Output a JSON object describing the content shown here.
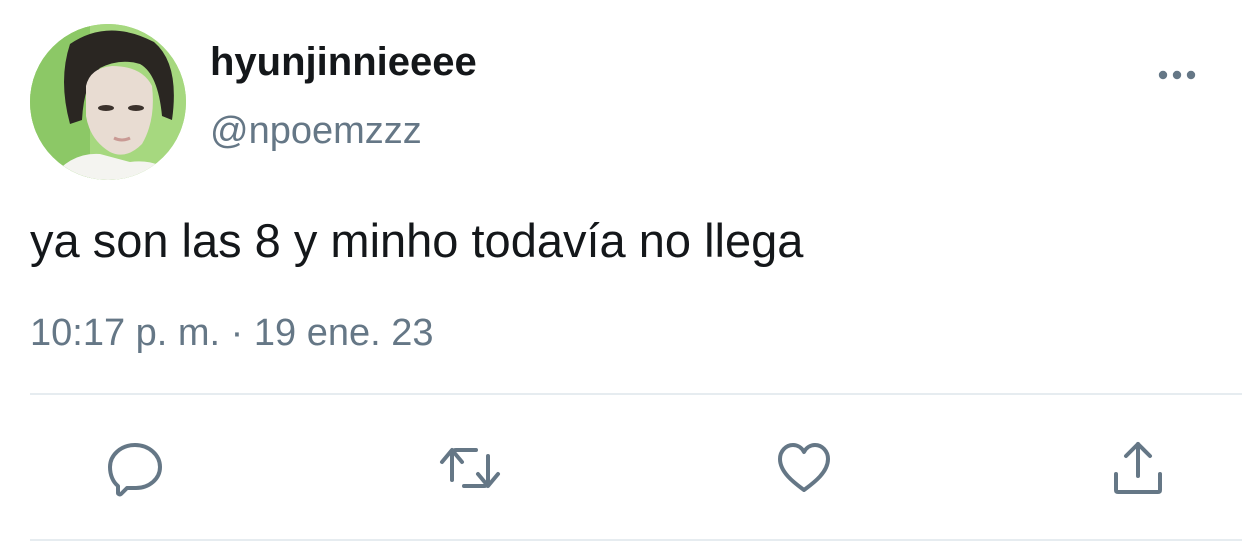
{
  "user": {
    "display_name": "hyunjinnieeee",
    "handle": "@npoemzzz",
    "avatar": "profile-photo"
  },
  "tweet": {
    "text": "ya son las 8 y minho todavía no llega",
    "timestamp": "10:17 p. m. · 19 ene. 23"
  },
  "icons": {
    "more": "more-horizontal-icon",
    "reply": "reply-icon",
    "retweet": "retweet-icon",
    "like": "heart-icon",
    "share": "share-icon"
  },
  "colors": {
    "text_primary": "#14171a",
    "text_secondary": "#657786",
    "divider": "#e6ecf0"
  }
}
